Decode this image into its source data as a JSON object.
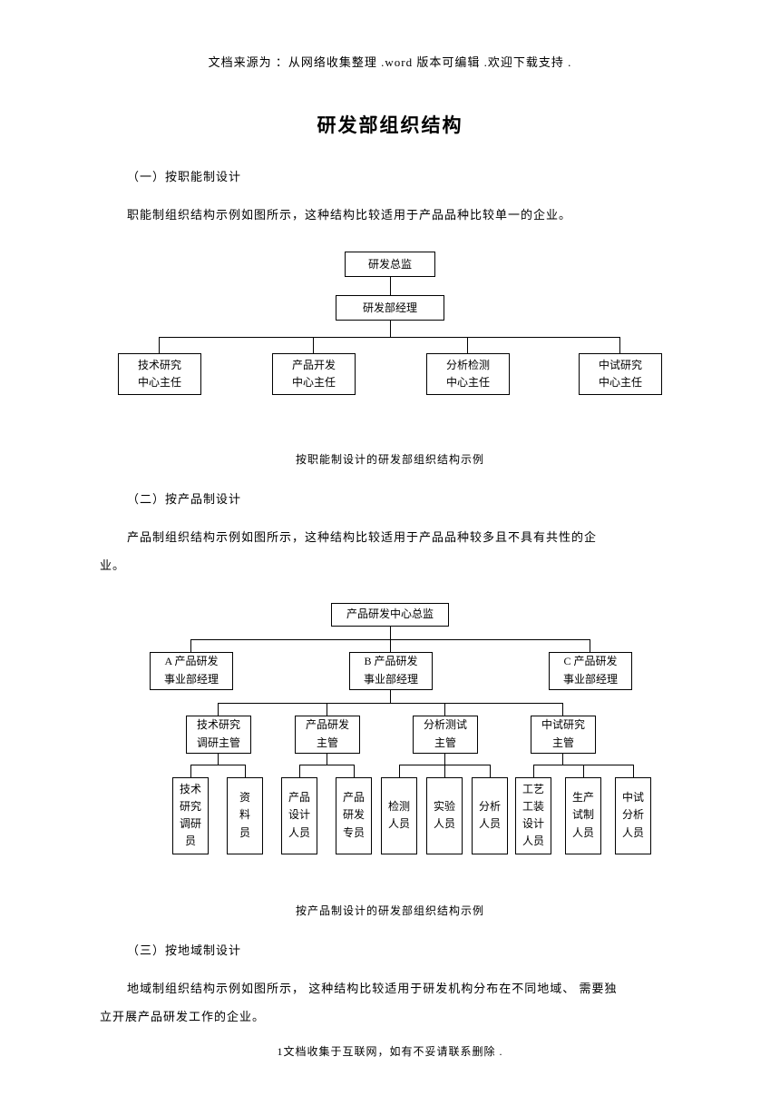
{
  "header": "文档来源为 ：从网络收集整理  .word 版本可编辑 .欢迎下载支持  .",
  "title": "研发部组织结构",
  "s1": {
    "h": "（一）按职能制设计",
    "p": "职能制组织结构示例如图所示，这种结构比较适用于产品品种比较单一的企业。",
    "cap": "按职能制设计的研发部组织结构示例"
  },
  "s2": {
    "h": "（二）按产品制设计",
    "p1": "产品制组织结构示例如图所示，这种结构比较适用于产品品种较多且不具有共性的企",
    "p2": "业。",
    "cap": "按产品制设计的研发部组织结构示例"
  },
  "s3": {
    "h": "（三）按地域制设计",
    "p1": "地域制组织结构示例如图所示，  这种结构比较适用于研发机构分布在不同地域、  需要独",
    "p2": "立开展产品研发工作的企业。"
  },
  "d1": {
    "a": "研发总监",
    "b": "研发部经理",
    "c1a": "技术研究",
    "c1b": "中心主任",
    "c2a": "产品开发",
    "c2b": "中心主任",
    "c3a": "分析检测",
    "c3b": "中心主任",
    "c4a": "中试研究",
    "c4b": "中心主任"
  },
  "d2": {
    "top": "产品研发中心总监",
    "b1a": "A 产品研发",
    "b1b": "事业部经理",
    "b2a": "B 产品研发",
    "b2b": "事业部经理",
    "b3a": "C 产品研发",
    "b3b": "事业部经理",
    "c1a": "技术研究",
    "c1b": "调研主管",
    "c2a": "产品研发",
    "c2b": "主管",
    "c3a": "分析测试",
    "c3b": "主管",
    "c4a": "中试研究",
    "c4b": "主管",
    "l1": "技术\n研究\n调研员",
    "l2": "资\n料\n员",
    "l3": "产品\n设计\n人员",
    "l4": "产品\n研发\n专员",
    "l5": "检测\n人员",
    "l6": "实验\n人员",
    "l7": "分析\n人员",
    "l8": "工艺\n工装\n设计\n人员",
    "l9": "生产\n试制\n人员",
    "l10": "中试\n分析\n人员"
  },
  "footer": "1文档收集于互联网，如有不妥请联系删除    ."
}
